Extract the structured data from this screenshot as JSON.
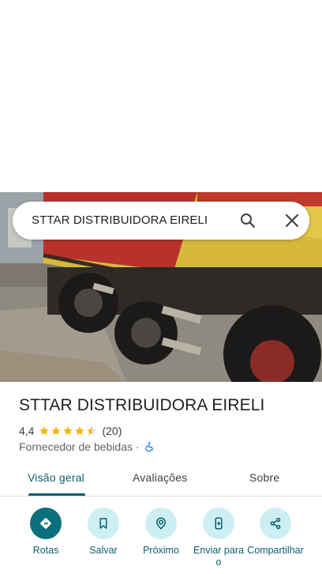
{
  "search": {
    "query": "STTAR DISTRIBUIDORA EIRELI",
    "search_icon": "search-icon",
    "clear_icon": "close-icon"
  },
  "place": {
    "name": "STTAR DISTRIBUIDORA EIRELI",
    "rating": "4,4",
    "rating_value": 4.4,
    "rating_max": 5,
    "review_count": "(20)",
    "category": "Fornecedor de bebidas",
    "separator": "·",
    "accessibility_icon": "wheelchair-icon"
  },
  "tabs": [
    {
      "label": "Visão geral",
      "active": true
    },
    {
      "label": "Avaliações",
      "active": false
    },
    {
      "label": "Sobre",
      "active": false
    }
  ],
  "actions": [
    {
      "label": "Rotas",
      "icon": "directions-icon"
    },
    {
      "label": "Salvar",
      "icon": "bookmark-icon"
    },
    {
      "label": "Próximo",
      "icon": "nearby-icon"
    },
    {
      "label": "Enviar para o",
      "icon": "send-to-phone-icon"
    },
    {
      "label": "Compartilhar",
      "icon": "share-icon"
    }
  ],
  "colors": {
    "accent": "#0b5f6d",
    "action_bg": "#cdeff3",
    "primary_action_bg": "#0b6f7c",
    "star": "#f4b400"
  }
}
